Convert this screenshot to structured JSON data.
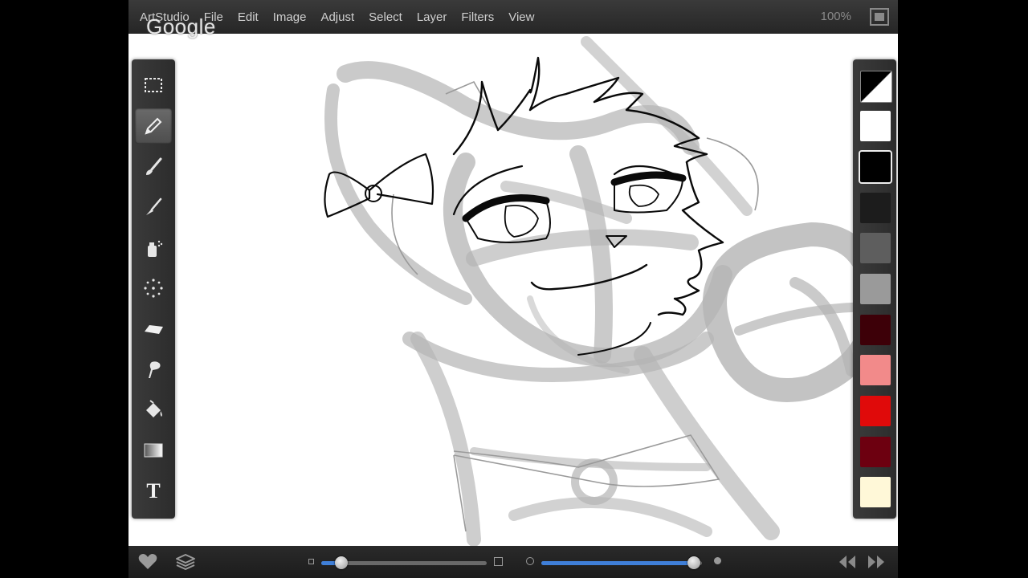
{
  "watermark": "Google",
  "menu": {
    "app_name": "ArtStudio",
    "items": [
      "File",
      "Edit",
      "Image",
      "Adjust",
      "Select",
      "Layer",
      "Filters",
      "View"
    ],
    "zoom": "100%"
  },
  "tools": [
    {
      "name": "marquee-select-icon",
      "active": false
    },
    {
      "name": "pencil-icon",
      "active": true
    },
    {
      "name": "brush-icon",
      "active": false
    },
    {
      "name": "smudge-brush-icon",
      "active": false
    },
    {
      "name": "spray-can-icon",
      "active": false
    },
    {
      "name": "scatter-dots-icon",
      "active": false
    },
    {
      "name": "eraser-icon",
      "active": false
    },
    {
      "name": "smudge-finger-icon",
      "active": false
    },
    {
      "name": "paint-bucket-icon",
      "active": false
    },
    {
      "name": "gradient-icon",
      "active": false
    },
    {
      "name": "text-tool-icon",
      "active": false,
      "label": "T"
    }
  ],
  "palette": [
    {
      "color": "split-black-white",
      "role": "primary-secondary"
    },
    {
      "color": "#ffffff"
    },
    {
      "color": "#000000",
      "selected": true
    },
    {
      "color": "#1c1c1c"
    },
    {
      "color": "#5e5e5e"
    },
    {
      "color": "#9a9a9a"
    },
    {
      "color": "#3d0008"
    },
    {
      "color": "#f28a8a"
    },
    {
      "color": "#e00a0a"
    },
    {
      "color": "#6d0010"
    },
    {
      "color": "#fff8d8"
    }
  ],
  "bottom_bar": {
    "brush_size_fraction": 0.12,
    "opacity_fraction": 0.95
  },
  "colors": {
    "accent": "#3f7fd8",
    "bar_bg": "#262626",
    "menu_text": "#cfcfcf"
  }
}
